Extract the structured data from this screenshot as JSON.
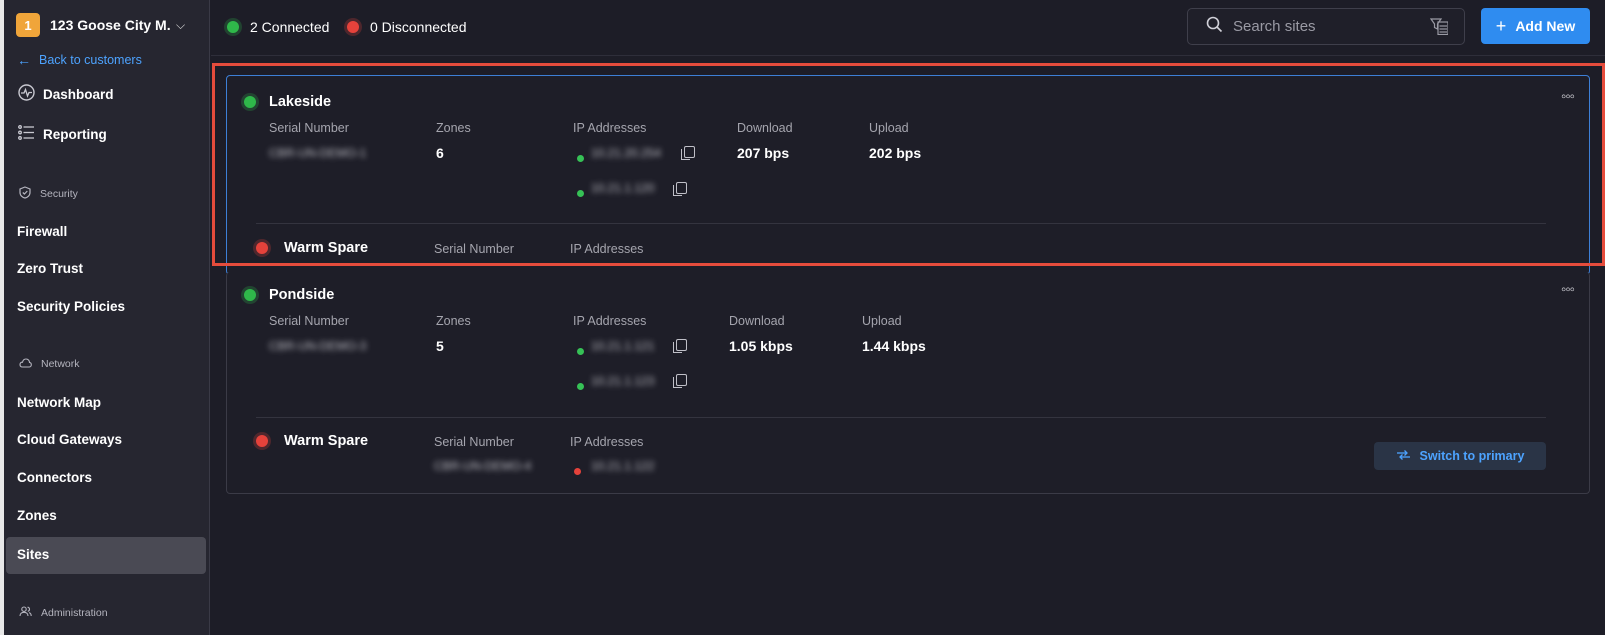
{
  "org": {
    "badge": "1",
    "name": "123 Goose City M..."
  },
  "sidebar": {
    "back_label": "Back to customers",
    "dashboard": "Dashboard",
    "reporting": "Reporting",
    "security_section": "Security",
    "firewall": "Firewall",
    "zero_trust": "Zero Trust",
    "security_policies": "Security Policies",
    "network_section": "Network",
    "network_map": "Network Map",
    "cloud_gateways": "Cloud Gateways",
    "connectors": "Connectors",
    "zones": "Zones",
    "sites": "Sites",
    "administration_section": "Administration"
  },
  "topbar": {
    "connected": "2 Connected",
    "disconnected": "0 Disconnected",
    "search_placeholder": "Search sites",
    "add_new": "Add New"
  },
  "labels": {
    "serial_number": "Serial Number",
    "zones": "Zones",
    "ip_addresses": "IP Addresses",
    "download": "Download",
    "upload": "Upload",
    "warm_spare": "Warm Spare",
    "switch_to_primary": "Switch to primary"
  },
  "sites": [
    {
      "name": "Lakeside",
      "serial": "CBR-UN-DEMO-1",
      "zones": "6",
      "ips": [
        "10.21.20.254",
        "10.21.1.120"
      ],
      "download": "207 bps",
      "upload": "202 bps"
    },
    {
      "name": "Pondside",
      "serial": "CBR-UN-DEMO-3",
      "zones": "5",
      "ips": [
        "10.21.1.121",
        "10.21.1.123"
      ],
      "download": "1.05 kbps",
      "upload": "1.44 kbps",
      "warm_spare_serial": "CBR-UN-DEMO-4",
      "warm_spare_ip": "10.21.1.122"
    }
  ],
  "colors": {
    "accent": "#2f8cf0",
    "connected": "#2fb84a",
    "disconnected": "#e5423b",
    "highlight": "#e54c3c"
  }
}
